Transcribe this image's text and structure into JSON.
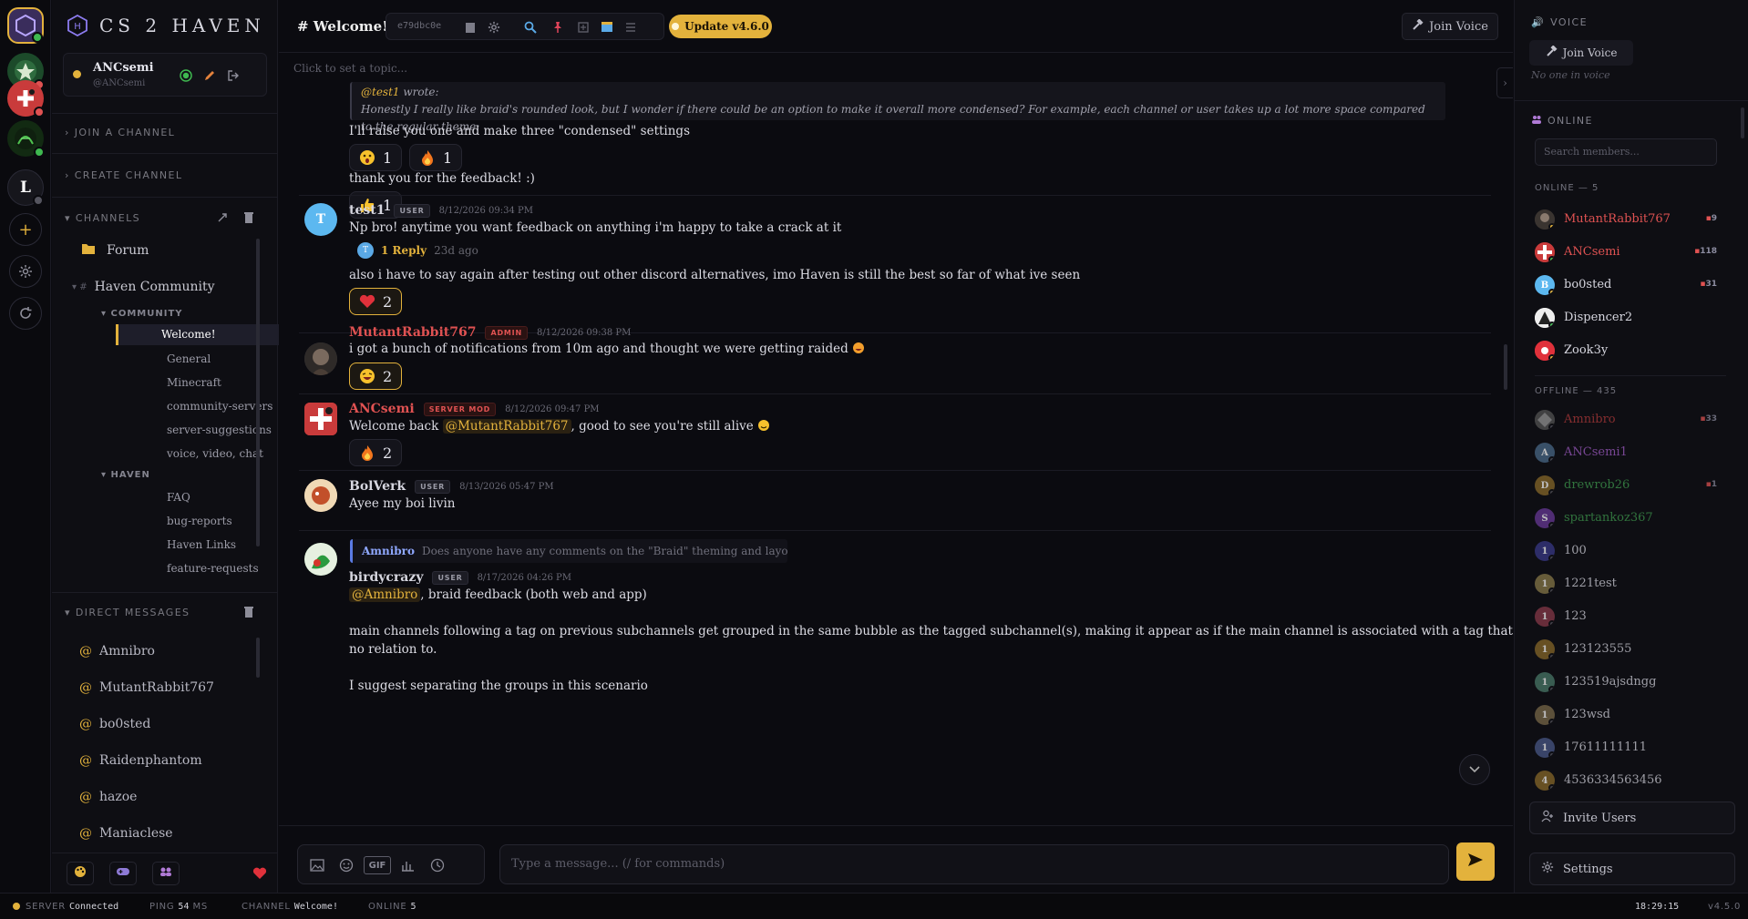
{
  "brand": {
    "name": "CS 2 HAVEN",
    "logo_letter": "H"
  },
  "user": {
    "name": "ANCsemi",
    "handle": "@ANCsemi"
  },
  "rail": {
    "home_letter": "L"
  },
  "sidebar": {
    "join_channel": "JOIN A CHANNEL",
    "create_channel": "CREATE CHANNEL",
    "channels_header": "CHANNELS",
    "forum": "Forum",
    "community": "Haven Community",
    "sub_community": "COMMUNITY",
    "sub_haven": "HAVEN",
    "channels_a": [
      "Welcome!",
      "General",
      "Minecraft",
      "community-servers",
      "server-suggestions",
      "voice, video, chat"
    ],
    "channels_b": [
      "FAQ",
      "bug-reports",
      "Haven Links",
      "feature-requests"
    ],
    "dm_header": "DIRECT MESSAGES",
    "dms": [
      "Amnibro",
      "MutantRabbit767",
      "bo0sted",
      "Raidenphantom",
      "hazoe",
      "Maniaclese"
    ]
  },
  "topbar": {
    "channel": "# Welcome!",
    "hash": "e79dbc0e",
    "update": "Update v4.6.0",
    "join_voice": "Join Voice",
    "topic_placeholder": "Click to set a topic..."
  },
  "messages": {
    "quote_who": "@test1",
    "quote_wrote": "wrote:",
    "quote_text": "Honestly I really like braid's rounded look, but I wonder if there could be an option to make it overall more condensed? For example, each channel or user takes up a lot more space compared to the regular theme:",
    "m1_text": "I'll raise you one and make three \"condensed\" settings",
    "m1_r1": "1",
    "m1_r2": "1",
    "m1_text2": "thank you for the feedback! :)",
    "m1_r3": "1",
    "m2_name": "test1",
    "m2_badge": "USER",
    "m2_time": "8/12/2026 09:34 PM",
    "m2_avatar": "T",
    "m2_text": "Np bro! anytime you want feedback on anything i'm happy to take a crack at it",
    "m2_reply_count": "1 Reply",
    "m2_reply_ago": "23d ago",
    "m2_text2": "also i have to say again after testing out other discord alternatives, imo Haven is still the best so far of what ive seen",
    "m2_r1": "2",
    "m3_name": "MutantRabbit767",
    "m3_badge": "ADMIN",
    "m3_time": "8/12/2026 09:38 PM",
    "m3_text": "i got a bunch of notifications from 10m ago and thought we were getting raided",
    "m3_r1": "2",
    "m4_name": "ANCsemi",
    "m4_badge": "SERVER MOD",
    "m4_time": "8/12/2026 09:47 PM",
    "m4_pre": "Welcome back",
    "m4_mention": "@MutantRabbit767",
    "m4_post": ", good to see you're still alive",
    "m4_r1": "2",
    "m5_name": "BolVerk",
    "m5_badge": "USER",
    "m5_time": "8/13/2026 05:47 PM",
    "m5_text": "Ayee my boi livin",
    "m6_ref_name": "Amnibro",
    "m6_ref_text": "Does anyone have any comments on the \"Braid\" theming and layout? Would like to g...",
    "m6_name": "birdycrazy",
    "m6_badge": "USER",
    "m6_time": "8/17/2026 04:26 PM",
    "m6_mention": "@Amnibro",
    "m6_post": ", braid feedback (both web and app)",
    "m6_p1": "main channels following a tag on previous subchannels get grouped in the same bubble as the tagged subchannel(s), making it appear as if the main channel is associated with a tag that it actually has",
    "m6_p2": "no relation to.",
    "m6_p3": "I suggest separating the groups in this scenario"
  },
  "composer": {
    "placeholder": "Type a message... (/ for commands)",
    "gif": "GIF"
  },
  "right": {
    "voice_header": "VOICE",
    "join_voice": "Join Voice",
    "no_voice": "No one in voice",
    "online_header": "ONLINE",
    "search_placeholder": "Search members...",
    "online_group": "ONLINE — 5",
    "offline_group": "OFFLINE — 435",
    "online": [
      {
        "name": "MutantRabbit767",
        "count": "9",
        "color": "#e05252"
      },
      {
        "name": "ANCsemi",
        "count": "118",
        "color": "#e05252"
      },
      {
        "name": "bo0sted",
        "count": "31",
        "color": "#d6d6df"
      },
      {
        "name": "Dispencer2",
        "count": "",
        "color": "#d6d6df"
      },
      {
        "name": "Zook3y",
        "count": "",
        "color": "#d6d6df"
      }
    ],
    "offline": [
      {
        "name": "Amnibro",
        "count": "33",
        "color": "#b43a3a",
        "letter": ""
      },
      {
        "name": "ANCsemi1",
        "count": "",
        "color": "#a15cc6",
        "letter": "A"
      },
      {
        "name": "drewrob26",
        "count": "1",
        "color": "#3f9b4e",
        "letter": "D"
      },
      {
        "name": "spartankoz367",
        "count": "",
        "color": "#3f9b4e",
        "letter": "S"
      },
      {
        "name": "100",
        "count": "",
        "color": "#d6d6df",
        "letter": "1"
      },
      {
        "name": "1221test",
        "count": "",
        "color": "#d6d6df",
        "letter": "1"
      },
      {
        "name": "123",
        "count": "",
        "color": "#d6d6df",
        "letter": "1"
      },
      {
        "name": "123123555",
        "count": "",
        "color": "#d6d6df",
        "letter": "1"
      },
      {
        "name": "123519ajsdngg",
        "count": "",
        "color": "#d6d6df",
        "letter": "1"
      },
      {
        "name": "123wsd",
        "count": "",
        "color": "#d6d6df",
        "letter": "1"
      },
      {
        "name": "17611111111",
        "count": "",
        "color": "#d6d6df",
        "letter": "1"
      },
      {
        "name": "4536334563456",
        "count": "",
        "color": "#d6d6df",
        "letter": "4"
      }
    ],
    "invite": "Invite Users",
    "settings": "Settings"
  },
  "status": {
    "server_label": "SERVER",
    "server_value": "Connected",
    "ping_label": "PING",
    "ping_value": "54",
    "ping_unit": "MS",
    "channel_label": "CHANNEL",
    "channel_value": "Welcome!",
    "online_label": "ONLINE",
    "online_value": "5",
    "time": "18:29:15",
    "version": "v4.5.0"
  },
  "colors": {
    "accent": "#e3b23c",
    "admin": "#e05252",
    "bg": "#0b0b10"
  }
}
